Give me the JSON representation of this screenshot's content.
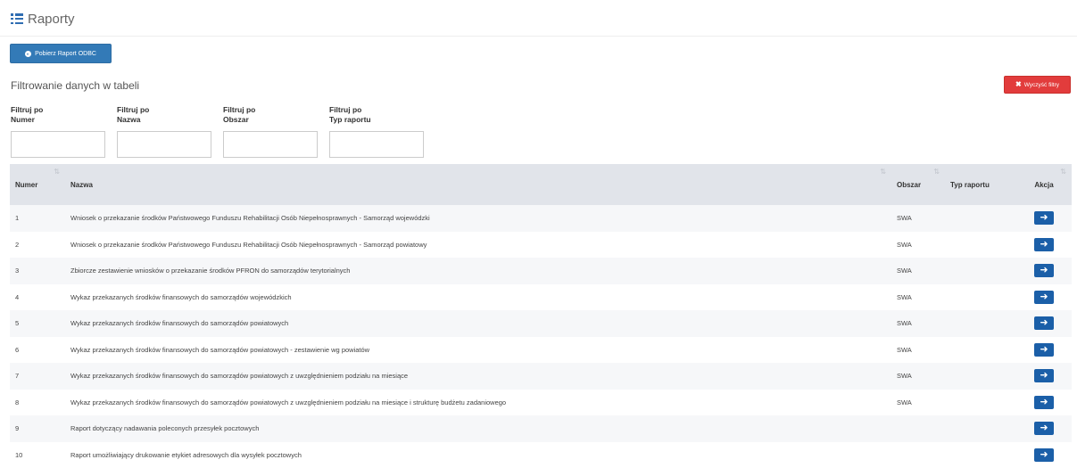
{
  "header": {
    "title": "Raporty",
    "icon": "list-icon"
  },
  "toolbar": {
    "download_label": "Pobierz Raport ODBC",
    "download_icon": "download-circle-icon"
  },
  "filters": {
    "heading": "Filtrowanie danych w tabeli",
    "clear_label": "Wyczyść filtry",
    "fields": [
      {
        "label_line1": "Filtruj po",
        "label_line2": "Numer",
        "value": ""
      },
      {
        "label_line1": "Filtruj po",
        "label_line2": "Nazwa",
        "value": ""
      },
      {
        "label_line1": "Filtruj po",
        "label_line2": "Obszar",
        "value": ""
      },
      {
        "label_line1": "Filtruj po",
        "label_line2": "Typ raportu",
        "value": ""
      }
    ]
  },
  "table": {
    "columns": [
      "Numer",
      "Nazwa",
      "Obszar",
      "Typ raportu",
      "Akcja"
    ],
    "action_icon": "arrow-right-icon",
    "rows": [
      {
        "numer": "1",
        "nazwa": "Wniosek o przekazanie środków Państwowego Funduszu Rehabilitacji Osób Niepełnosprawnych - Samorząd wojewódzki",
        "obszar": "SWA",
        "typ": ""
      },
      {
        "numer": "2",
        "nazwa": "Wniosek o przekazanie środków Państwowego Funduszu Rehabilitacji Osób Niepełnosprawnych - Samorząd powiatowy",
        "obszar": "SWA",
        "typ": ""
      },
      {
        "numer": "3",
        "nazwa": "Zbiorcze zestawienie wniosków o przekazanie środków PFRON do samorządów terytorialnych",
        "obszar": "SWA",
        "typ": ""
      },
      {
        "numer": "4",
        "nazwa": "Wykaz przekazanych środków finansowych do samorządów wojewódzkich",
        "obszar": "SWA",
        "typ": ""
      },
      {
        "numer": "5",
        "nazwa": "Wykaz przekazanych środków finansowych do samorządów powiatowych",
        "obszar": "SWA",
        "typ": ""
      },
      {
        "numer": "6",
        "nazwa": "Wykaz przekazanych środków finansowych do samorządów powiatowych - zestawienie wg powiatów",
        "obszar": "SWA",
        "typ": ""
      },
      {
        "numer": "7",
        "nazwa": "Wykaz przekazanych środków finansowych do samorządów powiatowych z uwzględnieniem podziału na miesiące",
        "obszar": "SWA",
        "typ": ""
      },
      {
        "numer": "8",
        "nazwa": "Wykaz przekazanych środków finansowych do samorządów powiatowych z uwzględnieniem podziału na miesiące i strukturę budżetu zadaniowego",
        "obszar": "SWA",
        "typ": ""
      },
      {
        "numer": "9",
        "nazwa": "Raport dotyczący nadawania poleconych przesyłek pocztowych",
        "obszar": "",
        "typ": ""
      },
      {
        "numer": "10",
        "nazwa": "Raport umożliwiający drukowanie etykiet adresowych dla wysyłek pocztowych",
        "obszar": "",
        "typ": ""
      }
    ]
  }
}
